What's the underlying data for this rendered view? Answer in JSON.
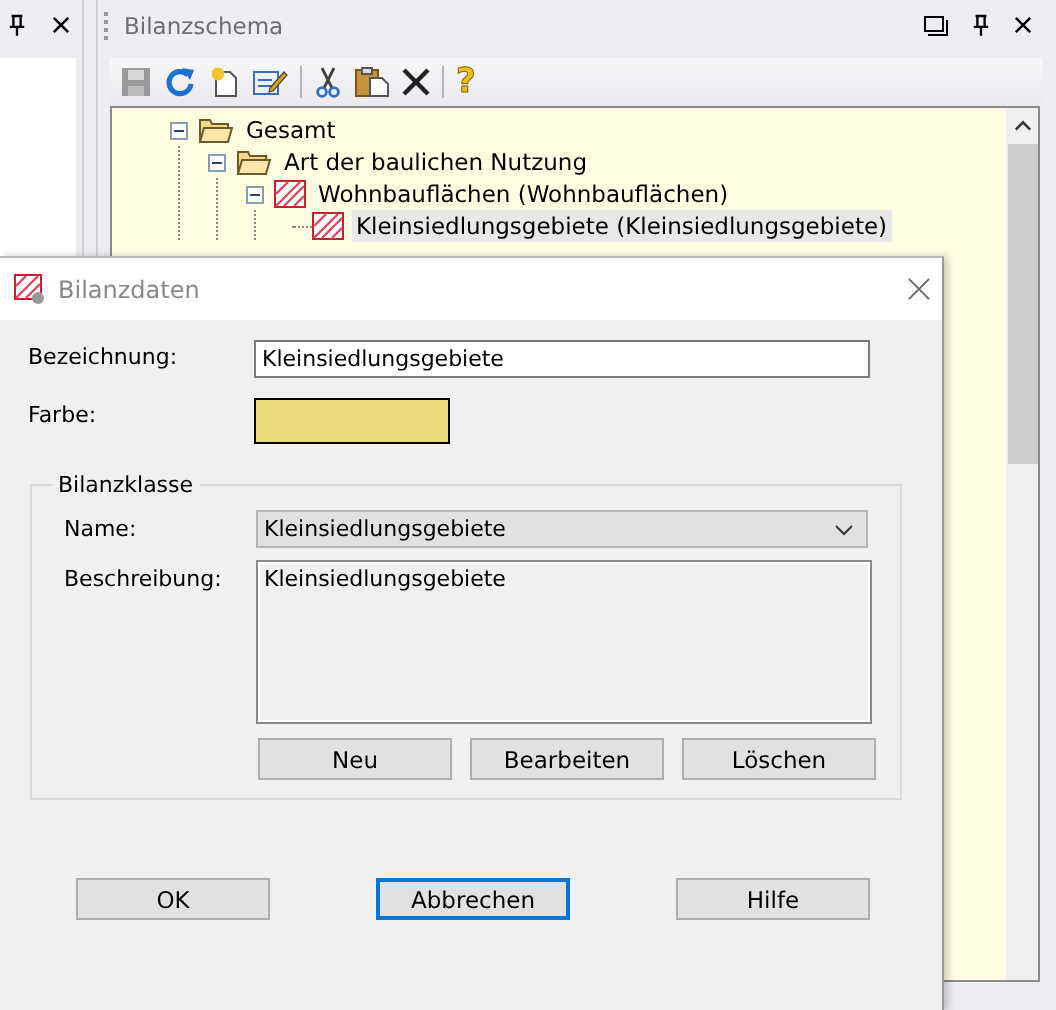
{
  "panel": {
    "title": "Bilanzschema",
    "help_glyph": "?"
  },
  "tree": [
    {
      "label": "Gesamt",
      "kind": "folder",
      "expanded": true,
      "selected": false,
      "children": [
        {
          "label": "Art der baulichen Nutzung",
          "kind": "folder",
          "expanded": true,
          "selected": false,
          "children": [
            {
              "label": "Wohnbauflächen (Wohnbauflächen)",
              "kind": "hatch",
              "expanded": true,
              "selected": false,
              "children": [
                {
                  "label": "Kleinsiedlungsgebiete (Kleinsiedlungsgebiete)",
                  "kind": "hatch",
                  "selected": true
                }
              ]
            }
          ]
        }
      ]
    }
  ],
  "dialog": {
    "title": "Bilanzdaten",
    "name_field": {
      "label": "Bezeichnung:",
      "value": "Kleinsiedlungsgebiete"
    },
    "color_field": {
      "label": "Farbe:",
      "color": "#ecd97a"
    },
    "group": {
      "title": "Bilanzklasse",
      "name": {
        "label": "Name:",
        "value": "Kleinsiedlungsgebiete"
      },
      "description": {
        "label": "Beschreibung:",
        "value": "Kleinsiedlungsgebiete"
      },
      "buttons": [
        "Neu",
        "Bearbeiten",
        "Löschen"
      ]
    },
    "buttons": [
      {
        "label": "OK",
        "focused": false
      },
      {
        "label": "Abbrechen",
        "focused": true
      },
      {
        "label": "Hilfe",
        "focused": false
      }
    ]
  }
}
